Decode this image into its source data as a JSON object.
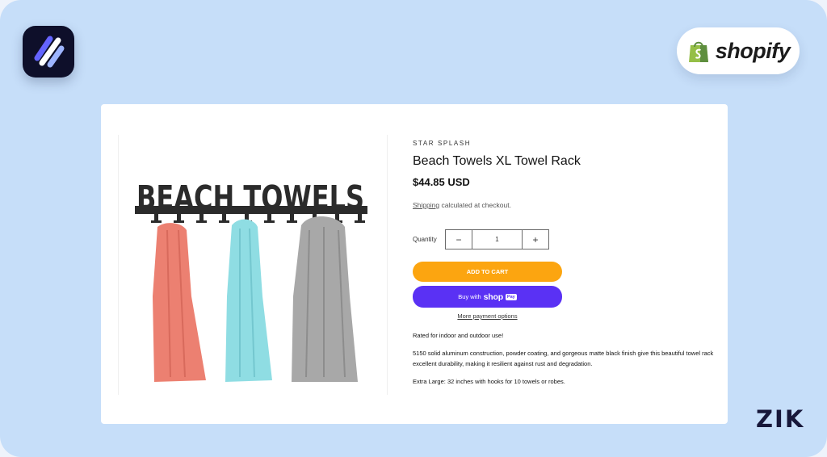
{
  "brand": {
    "shopify_label": "shopify",
    "footer_mark": "ZIK",
    "icons": {
      "app_logo": "stripes-logo-icon",
      "shopify_bag": "shopify-bag-icon"
    },
    "colors": {
      "background": "#c6def9",
      "cart_button": "#fca510",
      "shop_pay_button": "#5a31f4"
    }
  },
  "product": {
    "image_text": "BEACH TOWELS",
    "vendor": "STAR SPLASH",
    "title": "Beach Towels XL Towel Rack",
    "price": "$44.85 USD",
    "shipping_link": "Shipping",
    "shipping_text": " calculated at checkout.",
    "quantity_label": "Quantity",
    "quantity_value": "1",
    "decrement_symbol": "−",
    "increment_symbol": "+",
    "add_to_cart": "ADD TO CART",
    "buy_with": "Buy with",
    "shop_word": "shop",
    "pay_word": "Pay",
    "more_payment": "More payment options",
    "description": [
      "Rated for indoor and outdoor use!",
      "5150 solid aluminum construction, powder coating, and gorgeous matte black finish give this beautiful towel rack excellent durability, making it resilient against rust and degradation.",
      "Extra Large: 32 inches with hooks for 10 towels or robes."
    ]
  }
}
